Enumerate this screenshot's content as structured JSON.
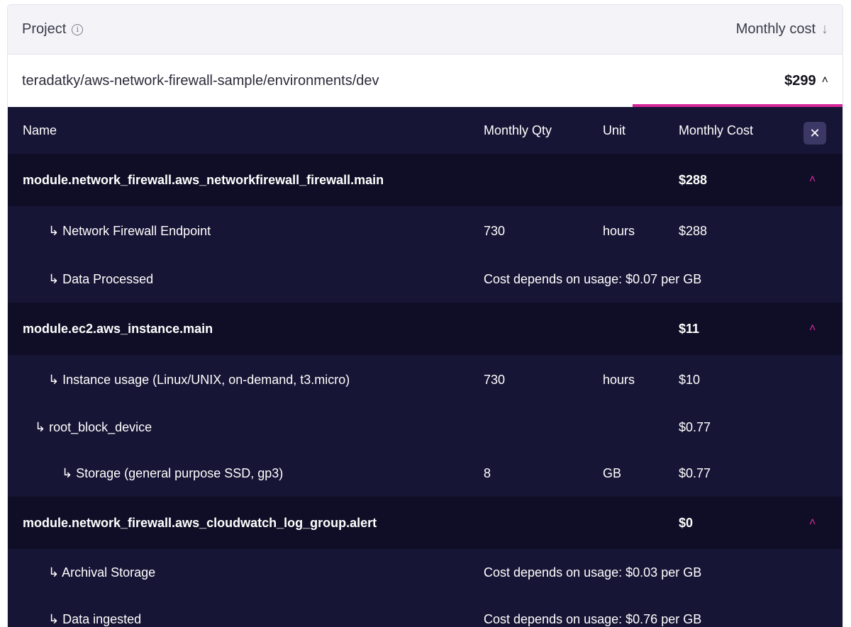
{
  "project_header": {
    "project_label": "Project",
    "info_icon": "info-icon",
    "monthly_cost_label": "Monthly cost",
    "sort_icon": "arrow-down-icon"
  },
  "project_row": {
    "path": "teradatky/aws-network-firewall-sample/environments/dev",
    "cost": "$299",
    "chevron_icon": "chevron-up-icon"
  },
  "colors": {
    "accent": "#d6279a",
    "panel_bg": "#171535",
    "resource_bg": "#100e26"
  },
  "table": {
    "headers": {
      "name": "Name",
      "qty": "Monthly Qty",
      "unit": "Unit",
      "cost": "Monthly Cost"
    },
    "close_icon": "close-icon",
    "rows": [
      {
        "type": "resource",
        "name": "module.network_firewall.aws_networkfirewall_firewall.main",
        "cost": "$288"
      },
      {
        "type": "sub",
        "name": "↳ Network Firewall Endpoint",
        "qty": "730",
        "unit": "hours",
        "cost": "$288"
      },
      {
        "type": "sub",
        "name": "↳ Data Processed",
        "note": "Cost depends on usage: $0.07 per GB"
      },
      {
        "type": "resource",
        "name": "module.ec2.aws_instance.main",
        "cost": "$11"
      },
      {
        "type": "sub",
        "name": "↳ Instance usage (Linux/UNIX, on-demand, t3.micro)",
        "qty": "730",
        "unit": "hours",
        "cost": "$10"
      },
      {
        "type": "sub",
        "name": "↳ root_block_device",
        "cost": "$0.77"
      },
      {
        "type": "sub",
        "name": "↳ Storage (general purpose SSD, gp3)",
        "qty": "8",
        "unit": "GB",
        "cost": "$0.77"
      },
      {
        "type": "resource",
        "name": "module.network_firewall.aws_cloudwatch_log_group.alert",
        "cost": "$0"
      },
      {
        "type": "sub",
        "name": "↳ Archival Storage",
        "note": "Cost depends on usage: $0.03 per GB"
      },
      {
        "type": "sub",
        "name": "↳ Data ingested",
        "note": "Cost depends on usage: $0.76 per GB"
      }
    ]
  }
}
